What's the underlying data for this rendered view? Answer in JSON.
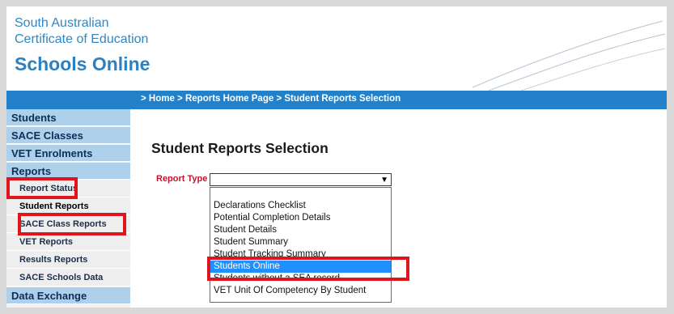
{
  "header": {
    "logo_line1": "South Australian",
    "logo_line2": "Certificate of Education",
    "logo_title": "Schools Online"
  },
  "breadcrumb": "> Home > Reports Home Page > Student Reports Selection",
  "sidebar": {
    "students": "Students",
    "sace_classes": "SACE Classes",
    "vet_enrolments": "VET Enrolments",
    "reports": "Reports",
    "report_status": "Report Status",
    "student_reports": "Student Reports",
    "sace_class_reports": "SACE Class Reports",
    "vet_reports": "VET Reports",
    "results_reports": "Results Reports",
    "sace_schools_data": "SACE Schools Data",
    "data_exchange": "Data Exchange"
  },
  "main": {
    "title": "Student Reports Selection",
    "report_type_label": "Report Type",
    "select_value": ""
  },
  "dropdown": {
    "options": [
      "Declarations Checklist",
      "Potential Completion Details",
      "Student Details",
      "Student Summary",
      "Student Tracking Summary",
      "Students Online",
      "Students without a SEA record",
      "VET Unit Of Competency By Student"
    ],
    "selected": "Students Online"
  },
  "colors": {
    "nav_bar": "#2381c9",
    "sidebar_main": "#aed0ea",
    "highlight": "#e0141c",
    "selected_option": "#1e90ff",
    "logo_blue": "#2f87c3"
  }
}
